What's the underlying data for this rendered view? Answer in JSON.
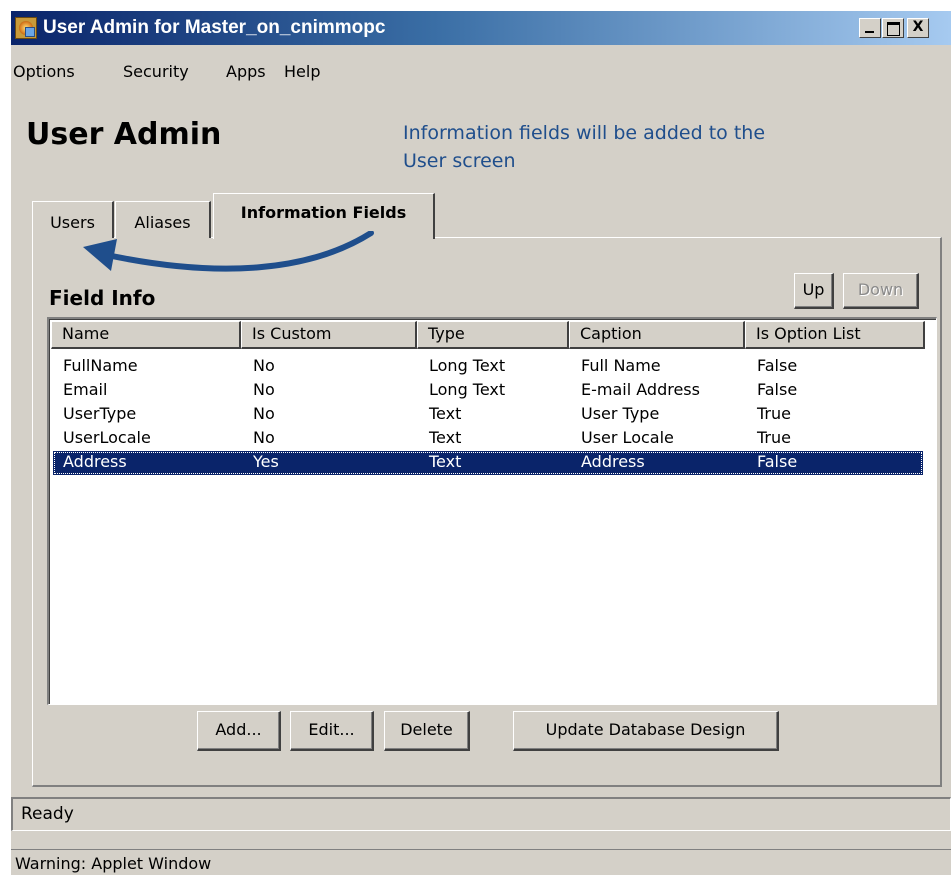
{
  "window": {
    "title": "User Admin for Master_on_cnimmopc",
    "title_icon": "java-applet-icon",
    "controls": [
      "minimize-icon",
      "maximize-icon",
      "close-icon"
    ],
    "close_glyph": "X"
  },
  "menu": {
    "items": [
      {
        "label": "Options"
      },
      {
        "label": "Security"
      },
      {
        "label": "Apps"
      },
      {
        "label": "Help"
      }
    ]
  },
  "header": {
    "title": "User Admin",
    "note": "Information fields will be added to the User screen"
  },
  "tabs": [
    {
      "label": "Users",
      "active": false
    },
    {
      "label": "Aliases",
      "active": false
    },
    {
      "label": "Information Fields",
      "active": true
    }
  ],
  "panel": {
    "section_title": "Field Info",
    "up_label": "Up",
    "down_label": "Down",
    "columns": [
      "Name",
      "Is Custom",
      "Type",
      "Caption",
      "Is Option List"
    ],
    "rows": [
      {
        "name": "FullName",
        "is_custom": "No",
        "type": "Long Text",
        "caption": "Full Name",
        "is_option_list": "False",
        "selected": false
      },
      {
        "name": "Email",
        "is_custom": "No",
        "type": "Long Text",
        "caption": "E-mail Address",
        "is_option_list": "False",
        "selected": false
      },
      {
        "name": "UserType",
        "is_custom": "No",
        "type": "Text",
        "caption": "User Type",
        "is_option_list": "True",
        "selected": false
      },
      {
        "name": "UserLocale",
        "is_custom": "No",
        "type": "Text",
        "caption": "User Locale",
        "is_option_list": "True",
        "selected": false
      },
      {
        "name": "Address",
        "is_custom": "Yes",
        "type": "Text",
        "caption": "Address",
        "is_option_list": "False",
        "selected": true
      }
    ],
    "buttons": {
      "add": "Add...",
      "edit": "Edit...",
      "delete": "Delete",
      "update": "Update Database Design"
    }
  },
  "status": {
    "text": "Ready",
    "warning": "Warning: Applet Window"
  },
  "colors": {
    "selection": "#0a246a",
    "annotation": "#1f4e8c"
  }
}
